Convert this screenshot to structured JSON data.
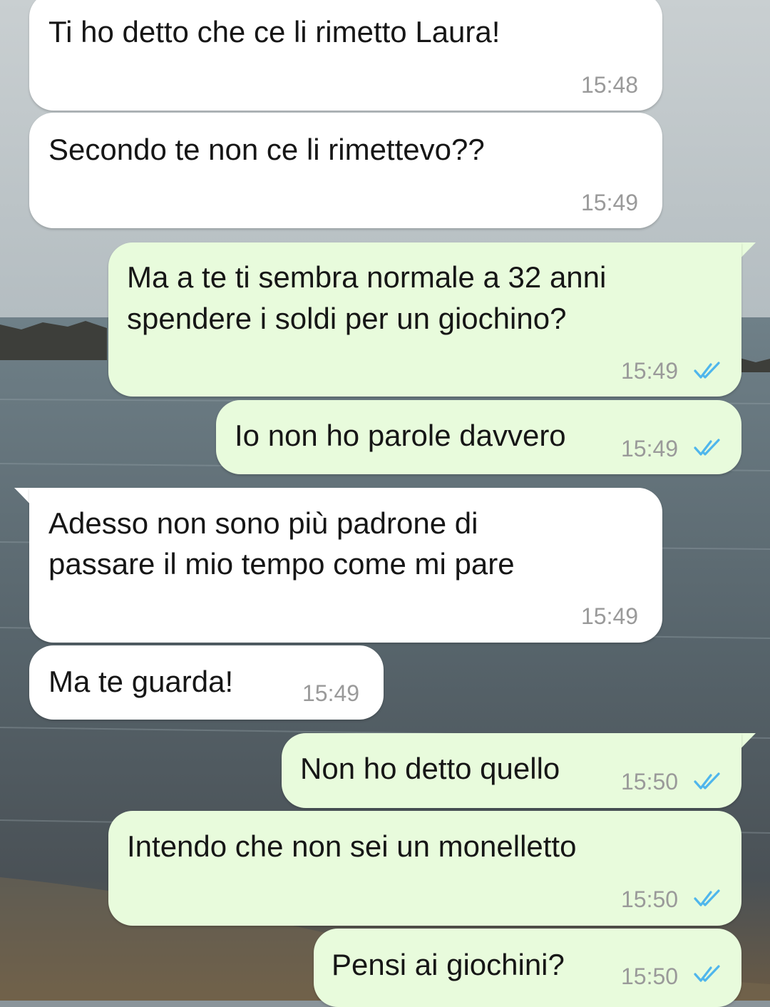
{
  "theme": {
    "incoming_bubble": "#ffffff",
    "outgoing_bubble": "#e8fbdc",
    "read_ticks": "#4fb6ec",
    "timestamp_color": "#9a9a9a",
    "wallpaper": "sea-and-rocks-photo"
  },
  "messages": [
    {
      "direction": "incoming",
      "lines": [
        "Ti ho detto che ce li rimetto Laura!"
      ],
      "time": "15:48"
    },
    {
      "direction": "incoming",
      "lines": [
        "Secondo te non ce li rimettevo??"
      ],
      "time": "15:49"
    },
    {
      "direction": "outgoing",
      "lines": [
        "Ma a te ti sembra normale a 32 anni",
        "spendere i soldi per un giochino?"
      ],
      "time": "15:49",
      "status": "read"
    },
    {
      "direction": "outgoing",
      "lines": [
        "Io non ho parole davvero"
      ],
      "time": "15:49",
      "status": "read"
    },
    {
      "direction": "incoming",
      "lines": [
        "Adesso non sono più padrone di",
        "passare il mio tempo come mi pare"
      ],
      "time": "15:49"
    },
    {
      "direction": "incoming",
      "lines": [
        "Ma te guarda!"
      ],
      "time": "15:49"
    },
    {
      "direction": "outgoing",
      "lines": [
        "Non ho detto quello"
      ],
      "time": "15:50",
      "status": "read"
    },
    {
      "direction": "outgoing",
      "lines": [
        "Intendo che non sei un monelletto"
      ],
      "time": "15:50",
      "status": "read"
    },
    {
      "direction": "outgoing",
      "lines": [
        "Pensi ai giochini?"
      ],
      "time": "15:50",
      "status": "read"
    }
  ]
}
